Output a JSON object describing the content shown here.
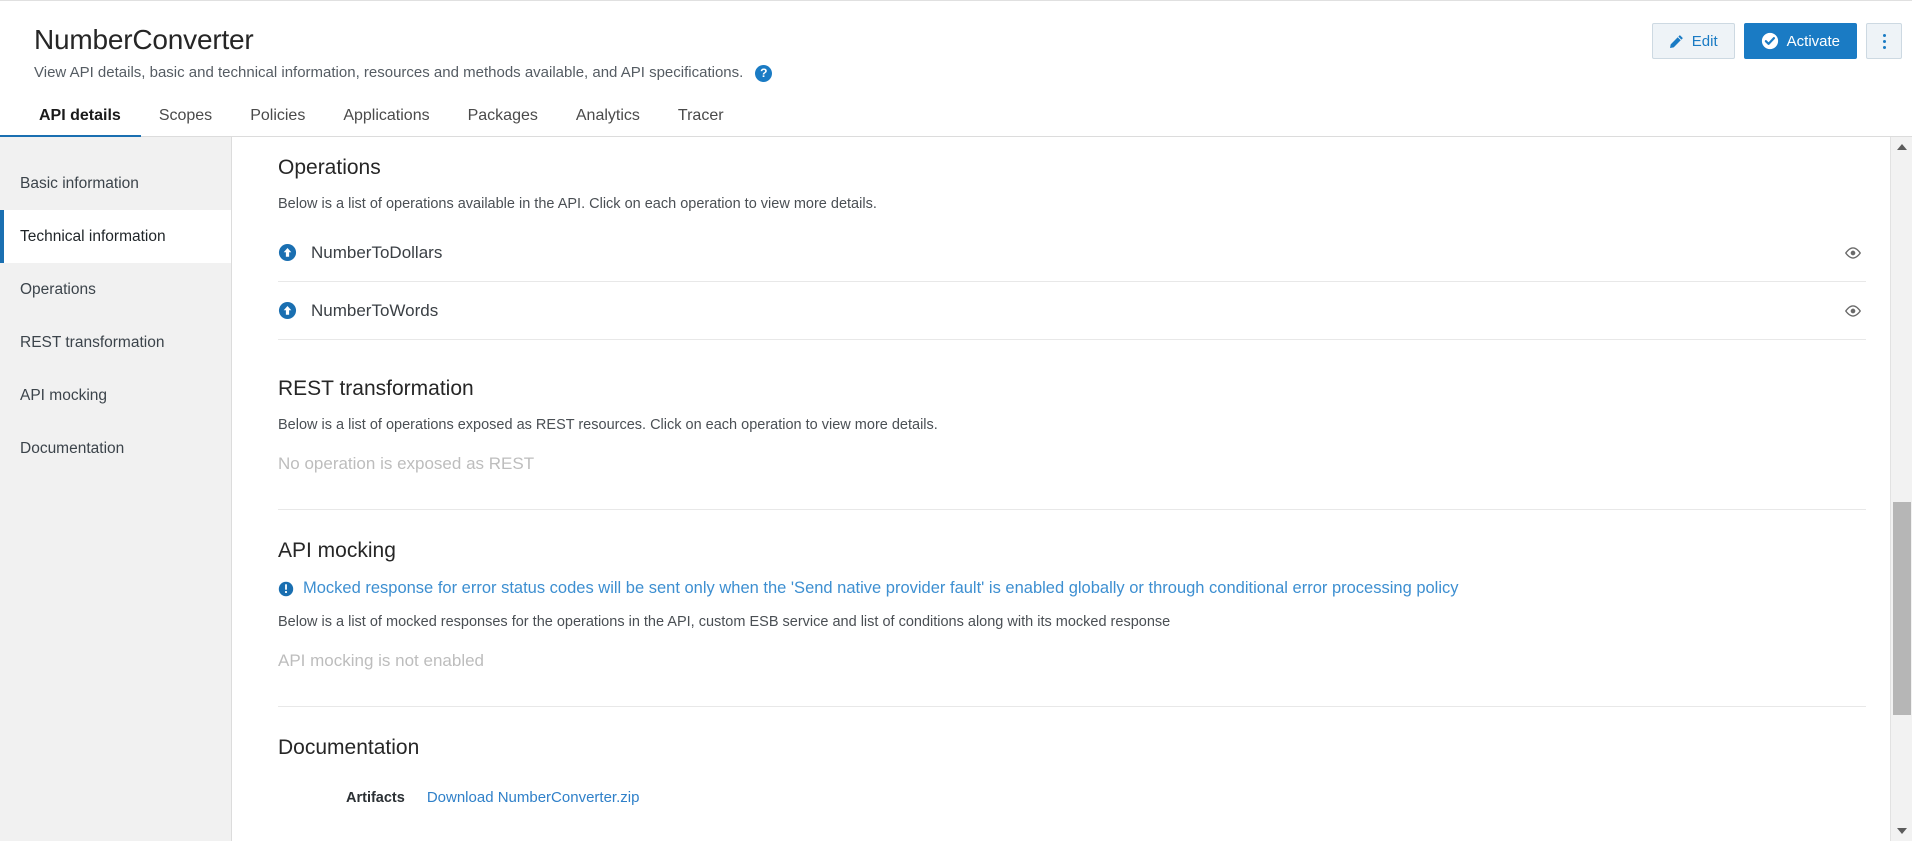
{
  "header": {
    "title": "NumberConverter",
    "subtitle": "View API details, basic and technical information, resources and methods available, and API specifications.",
    "help_icon": "help-circle-icon",
    "actions": {
      "edit_label": "Edit",
      "edit_icon": "pencil-icon",
      "activate_label": "Activate",
      "activate_icon": "check-circle-icon",
      "kebab_icon": "more-vertical-icon"
    }
  },
  "tabs": [
    {
      "label": "API details",
      "active": true
    },
    {
      "label": "Scopes",
      "active": false
    },
    {
      "label": "Policies",
      "active": false
    },
    {
      "label": "Applications",
      "active": false
    },
    {
      "label": "Packages",
      "active": false
    },
    {
      "label": "Analytics",
      "active": false
    },
    {
      "label": "Tracer",
      "active": false
    }
  ],
  "sidebar": {
    "items": [
      {
        "label": "Basic information",
        "active": false
      },
      {
        "label": "Technical information",
        "active": true
      },
      {
        "label": "Operations",
        "active": false
      },
      {
        "label": "REST transformation",
        "active": false
      },
      {
        "label": "API mocking",
        "active": false
      },
      {
        "label": "Documentation",
        "active": false
      }
    ]
  },
  "main": {
    "operations": {
      "title": "Operations",
      "description": "Below is a list of operations available in the API. Click on each operation to view more details.",
      "items": [
        {
          "name": "NumberToDollars",
          "icon": "operation-arrow-icon",
          "action_icon": "eye-icon"
        },
        {
          "name": "NumberToWords",
          "icon": "operation-arrow-icon",
          "action_icon": "eye-icon"
        }
      ]
    },
    "rest_transformation": {
      "title": "REST transformation",
      "description": "Below is a list of operations exposed as REST resources. Click on each operation to view more details.",
      "empty_state": "No operation is exposed as REST"
    },
    "api_mocking": {
      "title": "API mocking",
      "info_icon": "info-circle-icon",
      "info_message": "Mocked response for error status codes will be sent only when the 'Send native provider fault' is enabled globally or through conditional error processing policy",
      "description": "Below is a list of mocked responses for the operations in the API, custom ESB service and list of conditions along with its mocked response",
      "empty_state": "API mocking is not enabled"
    },
    "documentation": {
      "title": "Documentation",
      "artifacts_label": "Artifacts",
      "artifact_link": "Download NumberConverter.zip"
    }
  },
  "scrollbar": {
    "up_icon": "scroll-up-arrow-icon",
    "down_icon": "scroll-down-arrow-icon"
  },
  "colors": {
    "accent": "#1a7bc4",
    "active_tab_underline": "#1a6fb1",
    "link": "#2f80c9",
    "muted": "#bdbdbd"
  }
}
